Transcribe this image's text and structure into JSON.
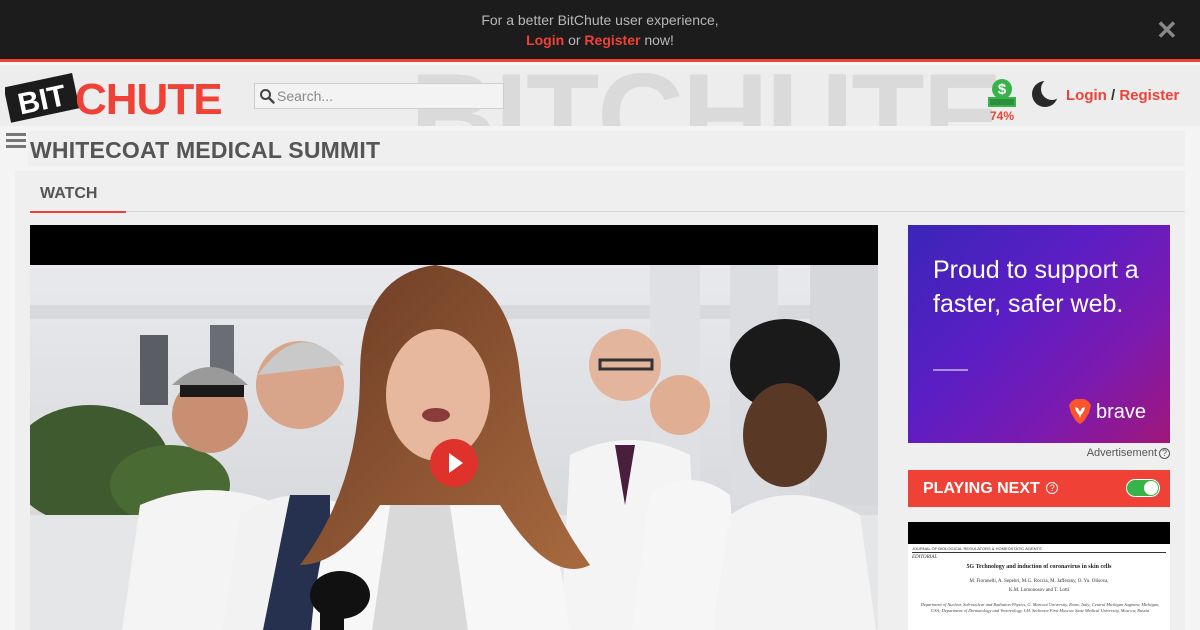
{
  "notice": {
    "line1": "For a better BitChute user experience,",
    "login": "Login",
    "or": "or",
    "register": "Register",
    "now": "now!",
    "close_glyph": "✕"
  },
  "header": {
    "logo_text": "BITCHUTE",
    "search_placeholder": "Search...",
    "wallet_percent": "74%",
    "login": "Login",
    "separator": "/",
    "register": "Register",
    "icons": [
      "search-icon",
      "wallet-icon",
      "moon-icon",
      "hamburger-icon"
    ]
  },
  "page": {
    "title": "WHITECOAT MEDICAL SUMMIT",
    "tab": "WATCH"
  },
  "ad": {
    "headline": "Proud to support a faster, safer web.",
    "brand": "brave",
    "label": "Advertisement",
    "help": "?"
  },
  "playing_next": {
    "label": "PLAYING NEXT",
    "help": "?",
    "autoplay_on": true
  },
  "thumbnail": {
    "journal": "JOURNAL OF BIOLOGICAL REGULATORS & HOMEOSTATIC AGENTS",
    "section": "EDITORIAL",
    "title": "5G Technology and induction of coronavirus in skin cells",
    "authors1": "M. Fioranelli, A. Sepehri, M.G. Roccia, M. Jafferany, O. Yu. Olisova,",
    "authors2": "K.M. Lomonosov and T. Lotti",
    "affiliation": "Department of Nuclear, Sub-nuclear and Radiation Physics, G. Marconi University, Rome, Italy; Central Michigan Saginaw, Michigan, USA; Department of Dermatology and Venereology, I.M. Sechenov First Moscow State Medical University, Moscow, Russia"
  },
  "colors": {
    "brand_red": "#ef4136",
    "dark_bar": "#1c1c1c",
    "toggle_green": "#37b34a"
  }
}
